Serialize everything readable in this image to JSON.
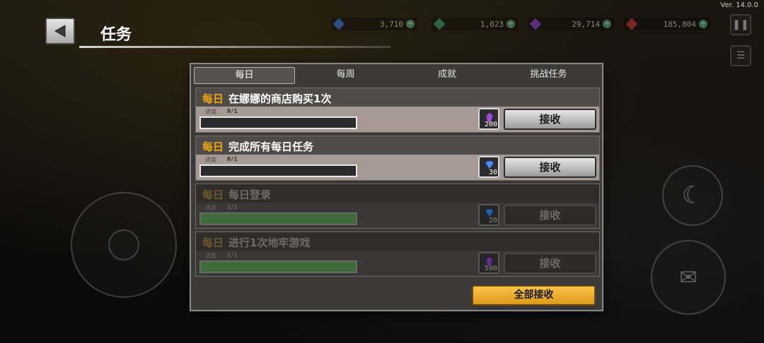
{
  "version": "Ver. 14.0.0",
  "header": {
    "title": "任务"
  },
  "currencies": [
    {
      "name": "gem-blue",
      "value": "3,710",
      "color": "#3a6fd8"
    },
    {
      "name": "gem-green",
      "value": "1,023",
      "color": "#3e9b6a"
    },
    {
      "name": "gem-purple",
      "value": "29,714",
      "color": "#8b3fc9"
    },
    {
      "name": "gem-red",
      "value": "185,804",
      "color": "#c8343a"
    }
  ],
  "tabs": [
    {
      "label": "每日",
      "active": true
    },
    {
      "label": "每周",
      "active": false
    },
    {
      "label": "成就",
      "active": false
    },
    {
      "label": "挑战任务",
      "active": false
    }
  ],
  "quests": [
    {
      "tag": "每日",
      "title": "在娜娜的商店购买1次",
      "progress_label": "进度",
      "progress": "0/1",
      "progress_fraction": 0,
      "reward_icon": "purple-crystal-icon",
      "reward_amount": "200",
      "claim_label": "接收",
      "completed": false
    },
    {
      "tag": "每日",
      "title": "完成所有每日任务",
      "progress_label": "进度",
      "progress": "0/1",
      "progress_fraction": 0,
      "reward_icon": "blue-gem-icon",
      "reward_amount": "30",
      "claim_label": "接收",
      "completed": false
    },
    {
      "tag": "每日",
      "title": "每日登录",
      "progress_label": "进度",
      "progress": "1/1",
      "progress_fraction": 1,
      "reward_icon": "blue-gem-icon",
      "reward_amount": "20",
      "claim_label": "接收",
      "completed": true
    },
    {
      "tag": "每日",
      "title": "进行1次地牢游戏",
      "progress_label": "进度",
      "progress": "1/1",
      "progress_fraction": 1,
      "reward_icon": "purple-crystal-icon",
      "reward_amount": "500",
      "claim_label": "接收",
      "completed": true
    }
  ],
  "claim_all_label": "全部接收",
  "colors": {
    "accent": "#f2a60c",
    "claim_all": "#e09a18",
    "progress_fill": "#3f6a3c"
  }
}
